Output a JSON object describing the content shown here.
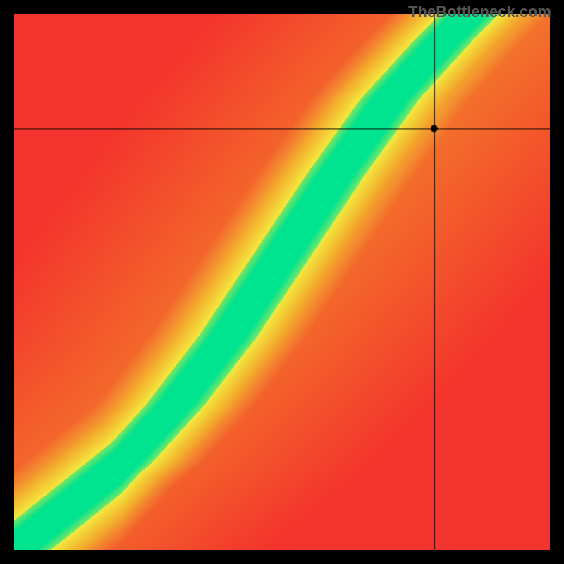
{
  "watermark": "TheBottleneck.com",
  "chart_data": {
    "type": "heatmap",
    "title": "",
    "xlabel": "",
    "ylabel": "",
    "xlim": [
      0,
      1
    ],
    "ylim": [
      0,
      1
    ],
    "marker": {
      "x": 0.785,
      "y": 0.786
    },
    "crosshair": {
      "x": 0.785,
      "y": 0.786
    },
    "optimal_ridge": [
      {
        "x": 0.0,
        "y": 0.0
      },
      {
        "x": 0.1,
        "y": 0.08
      },
      {
        "x": 0.2,
        "y": 0.16
      },
      {
        "x": 0.3,
        "y": 0.27
      },
      {
        "x": 0.4,
        "y": 0.4
      },
      {
        "x": 0.5,
        "y": 0.55
      },
      {
        "x": 0.6,
        "y": 0.7
      },
      {
        "x": 0.7,
        "y": 0.84
      },
      {
        "x": 0.8,
        "y": 0.95
      },
      {
        "x": 0.85,
        "y": 1.0
      }
    ],
    "colors": {
      "optimal": "#00e38f",
      "midband": "#f3ea3e",
      "warm": "#f39a2a",
      "poor": "#f3332d"
    },
    "band_widths": {
      "green_half": 0.055,
      "yellow_half": 0.11
    }
  }
}
